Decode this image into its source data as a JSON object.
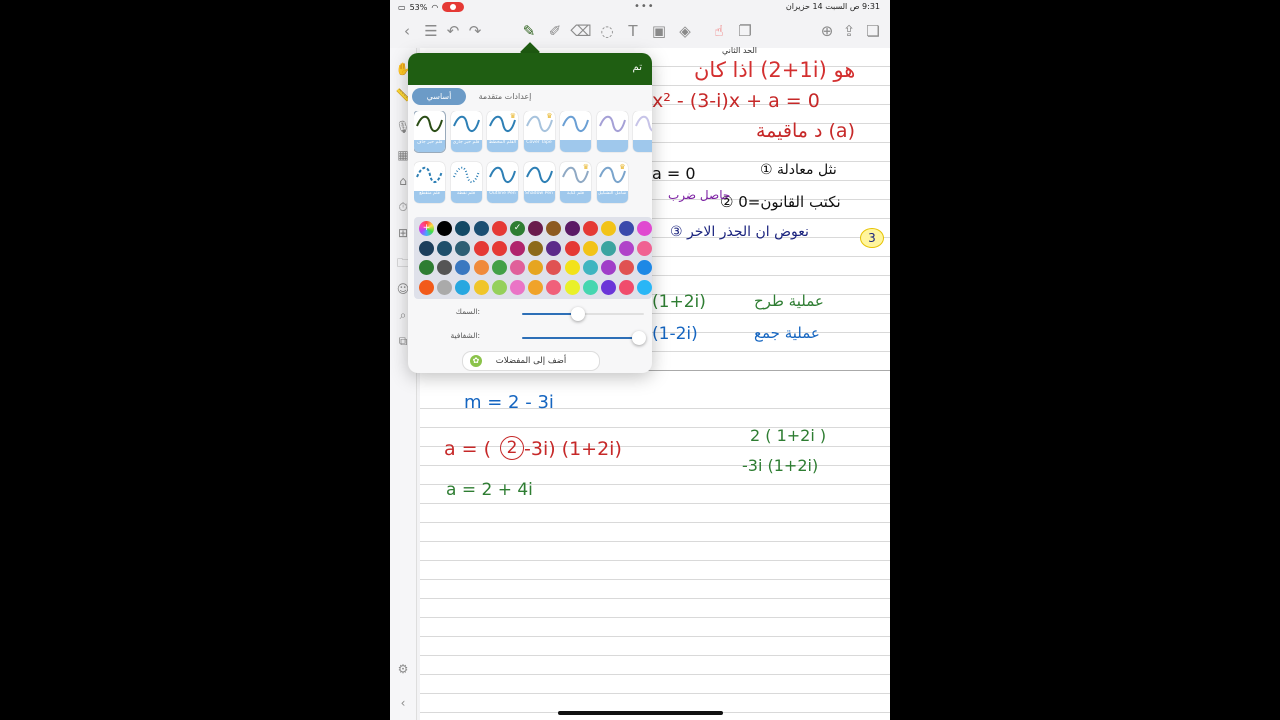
{
  "status_bar": {
    "time": "9:31",
    "period": "ص",
    "date": "السبت 14 حزيران",
    "battery": "53%"
  },
  "popover": {
    "done_label": "تم",
    "tabs": {
      "basic": "أساسي",
      "advanced": "إعدادات متقدمة"
    },
    "pens_row1": [
      {
        "label": "قلم حبر جاف",
        "color": "#2b4d16",
        "crown": false
      },
      {
        "label": "قلم حبر جاري",
        "color": "#2d7fb5",
        "crown": false
      },
      {
        "label": "القلم المخطط",
        "color": "#2d7fb5",
        "crown": true
      },
      {
        "label": "Cover Tape",
        "color": "#a7c3dd",
        "crown": true
      },
      {
        "label": "",
        "color": "#6a9fd4",
        "crown": false
      },
      {
        "label": "",
        "color": "#a5a0d6",
        "crown": false
      },
      {
        "label": "",
        "color": "#c7c4e8",
        "crown": false
      }
    ],
    "pens_row2": [
      {
        "label": "قلم متقطع",
        "color": "#2d7fb5",
        "crown": false
      },
      {
        "label": "قلم نقطة",
        "color": "#2d7fb5",
        "crown": false
      },
      {
        "label": "Outline Pen",
        "color": "#2d7fb5",
        "crown": false
      },
      {
        "label": "Shadow Pen",
        "color": "#2d7fb5",
        "crown": false
      },
      {
        "label": "قلم كتابة",
        "color": "#8fa9c4",
        "crown": true
      },
      {
        "label": "شامل التشكيل",
        "color": "#7aa4cc",
        "crown": true
      }
    ],
    "color_rows": [
      [
        "#d858d3",
        "#000000",
        "#144a66",
        "#1b4e72",
        "#e53935",
        "#2e7d32",
        "#6a1b4d",
        "#8d5a20",
        "#5c1a66",
        "#e53935",
        "#f2c318",
        "#3949ab",
        "#e04ad0",
        "#d84315"
      ],
      [
        "#1c3e5c",
        "#1f4f6b",
        "#2e5f74",
        "#e53935",
        "#e53935",
        "#b0246c",
        "#8d6a1a",
        "#5c2a8a",
        "#e53935",
        "#f2c318",
        "#3ba4a0",
        "#b043c9",
        "#f06292",
        "#1a237e"
      ],
      [
        "#2e7d32",
        "#555555",
        "#3a78c0",
        "#f08a3a",
        "#43a047",
        "#e0609a",
        "#e6a520",
        "#e05252",
        "#f2e21a",
        "#3fb5c0",
        "#a03ec8",
        "#e05252",
        "#1e88e5",
        "#8e24aa"
      ],
      [
        "#f25a1a",
        "#aaaaaa",
        "#27a7e0",
        "#f0c52a",
        "#95d05b",
        "#ea74c6",
        "#f0a32a",
        "#f0607a",
        "#e9f02a",
        "#46d6b0",
        "#6a35d8",
        "#f04c6c",
        "#29b6f6",
        "#c2185b"
      ]
    ],
    "selected_color_index": [
      0,
      5
    ],
    "thickness": {
      "label": "السمك:",
      "value": 0.46
    },
    "opacity": {
      "label": "الشفافية:",
      "value": 0.96
    },
    "favorites_label": "أضف إلى المفضلات"
  },
  "notes": {
    "line1": "اذا كان (1+2i) هو",
    "line1b": "الحد الثاني",
    "line2": "x² - (3-i)x + a = 0",
    "line3": "د ماقيمة (a)",
    "line4": "① نثل معادلة",
    "line4b": "a = 0",
    "line5": "② نكتب القانون=0",
    "line5b": "حاصل ضرب",
    "line6": "③ نعوض ان الجذر الاخر",
    "line7a": "(1+2i)",
    "line7b": "عملية طرح",
    "line8a": "(1-2i)",
    "line8b": "عملية جمع",
    "eq1": "m = 2 - 3i",
    "eq2a": "a = (",
    "eq2b": "2",
    "eq2c": "-3i) (1+2i)",
    "eq3": "a = 2 + 4i",
    "side1": "2 ( 1+2i )",
    "side2": "-3i (1+2i)",
    "circle_num": "3"
  }
}
